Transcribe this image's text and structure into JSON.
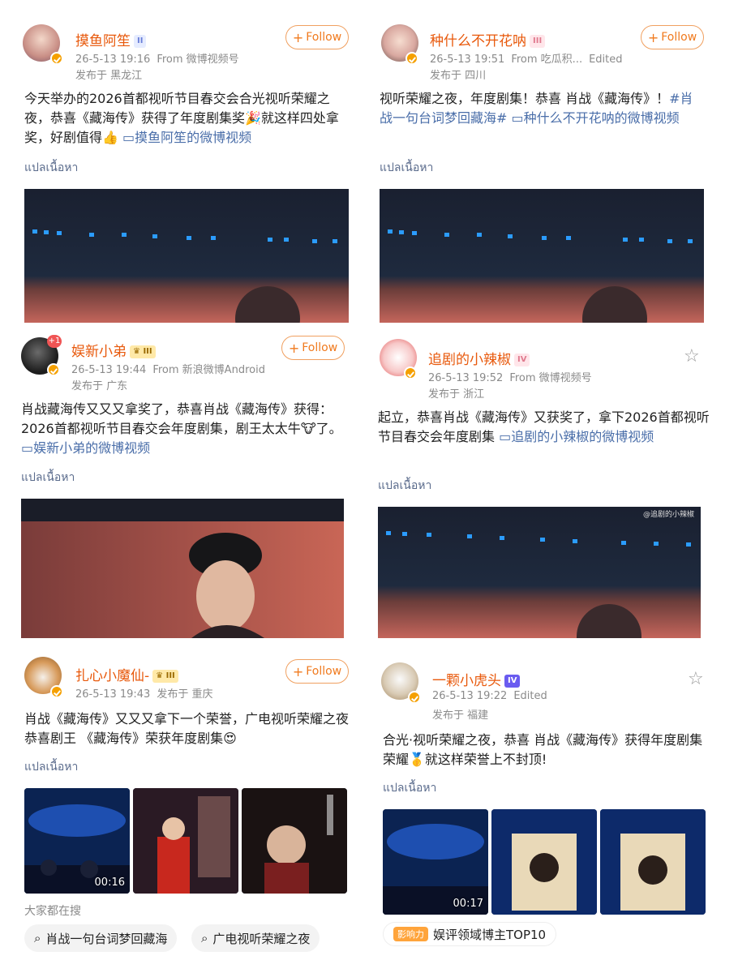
{
  "colors": {
    "accent": "#f07a1e",
    "username": "#e8590c",
    "link": "#4a6ea9",
    "meta": "#8a8a8a"
  },
  "follow_label": "Follow",
  "translate_label": "แปลเนื้อหา",
  "posts": [
    {
      "user": "摸鱼阿笙",
      "level": "II",
      "time": "26-5-13 19:16",
      "source": "From 微博视频号",
      "loc": "发布于 黑龙江",
      "text": "今天举办的2026首都视听节目春交会合光视听荣耀之夜，恭喜《藏海传》获得了年度剧集奖🎉就这样四处拿奖，好剧值得👍",
      "link": "摸鱼阿笙的微博视频"
    },
    {
      "user": "种什么不开花呐",
      "level": "III",
      "time": "26-5-13 19:51",
      "source": "From 吃瓜积...",
      "edited": "Edited",
      "loc": "发布于 四川",
      "text": "视听荣耀之夜，年度剧集！恭喜 肖战《藏海传》！",
      "tag": "#肖战一句台词梦回藏海#",
      "link": "种什么不开花呐的微博视频"
    },
    {
      "user": "娱新小弟",
      "level": "III",
      "notif": "+1",
      "time": "26-5-13 19:44",
      "source": "From 新浪微博Android",
      "loc": "发布于 广东",
      "text": "肖战藏海传又又又拿奖了，恭喜肖战《藏海传》获得：2026首都视听节目春交会年度剧集，剧王太太牛🐮了。",
      "link": "娱新小弟的微博视频"
    },
    {
      "user": "追剧的小辣椒",
      "level": "IV",
      "time": "26-5-13 19:52",
      "source": "From 微博视频号",
      "loc": "发布于 浙江",
      "text": "起立，恭喜肖战《藏海传》又获奖了，拿下2026首都视听节目春交会年度剧集",
      "link": "追剧的小辣椒的微博视频",
      "watermark": "@追剧的小辣椒"
    },
    {
      "user": "扎心小魔仙-",
      "level": "III",
      "time": "26-5-13 19:43",
      "loc": "发布于 重庆",
      "text": "肖战《藏海传》又又又拿下一个荣誉，广电视听荣耀之夜恭喜剧王 《藏海传》荣获年度剧集😍",
      "video_duration": "00:16"
    },
    {
      "user": "一颗小虎头",
      "level": "IV",
      "time": "26-5-13 19:22",
      "edited": "Edited",
      "loc": "发布于 福建",
      "text": "合光·视听荣耀之夜，恭喜 肖战《藏海传》获得年度剧集荣耀🥇就这样荣誉上不封顶!",
      "video_duration": "00:17"
    }
  ],
  "search_section": {
    "title": "大家都在搜",
    "chips": [
      "肖战一句台词梦回藏海",
      "广电视听荣耀之夜"
    ]
  },
  "influence": {
    "badge": "影响力",
    "text": "娱评领域博主TOP10"
  }
}
